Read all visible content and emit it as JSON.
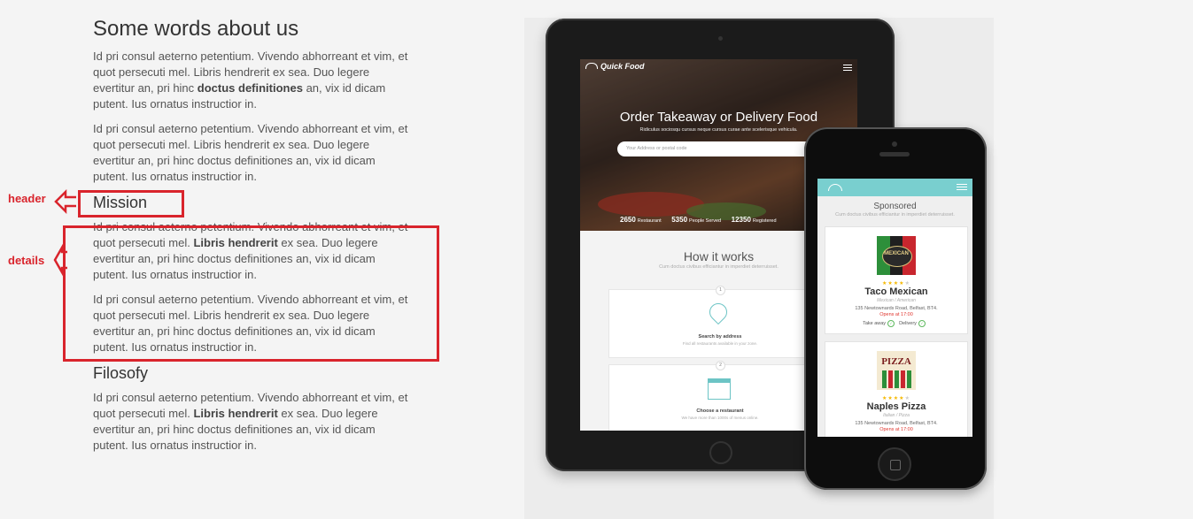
{
  "about": {
    "title": "Some words about us",
    "p1_before": "Id pri consul aeterno petentium. Vivendo abhorreant et vim, et quot persecuti mel. Libris hendrerit ex sea. Duo legere evertitur an, pri hinc ",
    "p1_bold": "doctus definitiones",
    "p1_after": " an, vix id dicam putent. Ius ornatus instructior in.",
    "p2": "Id pri consul aeterno petentium. Vivendo abhorreant et vim, et quot persecuti mel. Libris hendrerit ex sea. Duo legere evertitur an, pri hinc doctus definitiones an, vix id dicam putent. Ius ornatus instructior in."
  },
  "mission": {
    "title": "Mission",
    "p1_before": "Id pri consul aeterno petentium. Vivendo abhorreant et vim, et quot persecuti mel. ",
    "p1_bold": "Libris hendrerit",
    "p1_after": " ex sea. Duo legere evertitur an, pri hinc doctus definitiones an, vix id dicam putent. Ius ornatus instructior in.",
    "p2": "Id pri consul aeterno petentium. Vivendo abhorreant et vim, et quot persecuti mel. Libris hendrerit ex sea. Duo legere evertitur an, pri hinc doctus definitiones an, vix id dicam putent. Ius ornatus instructior in."
  },
  "filosofy": {
    "title": "Filosofy",
    "p1_before": "Id pri consul aeterno petentium. Vivendo abhorreant et vim, et quot persecuti mel. ",
    "p1_bold": "Libris hendrerit",
    "p1_after": " ex sea. Duo legere evertitur an, pri hinc doctus definitiones an, vix id dicam putent. Ius ornatus instructior in."
  },
  "annotations": {
    "header_label": "header",
    "details_label": "details",
    "color": "#d9242c"
  },
  "tablet": {
    "logo": "Quick Food",
    "hero_title": "Order Takeaway or Delivery Food",
    "hero_sub": "Ridiculus sociosqu cursus neque cursus curae ante scelerisque vehicula.",
    "address_placeholder": "Your Address or postal code",
    "stats": [
      {
        "num": "2650",
        "label": "Restaurant"
      },
      {
        "num": "5350",
        "label": "People Served"
      },
      {
        "num": "12350",
        "label": "Registered"
      }
    ],
    "how_title": "How it works",
    "how_sub": "Cum doctus civibus efficiantur in imperdiet deterruisset.",
    "steps": [
      {
        "num": "1",
        "title": "Search by address",
        "sub": "Find all restaurants available in your zone."
      },
      {
        "num": "2",
        "title": "Choose a restaurant",
        "sub": "We have more than 1000s of menus online."
      }
    ]
  },
  "phone": {
    "sponsored_title": "Sponsored",
    "sponsored_sub": "Cum doctus civibus efficiantur in imperdiet deterruisset.",
    "accent": "#79cfcf",
    "cards": [
      {
        "logo": "MEXICAN",
        "name": "Taco Mexican",
        "type": "Mexican / American",
        "address": "135 Newtownards Road, Belfast, BT4.",
        "open": "Opens at 17:00",
        "opt1": "Take away",
        "opt2": "Delivery"
      },
      {
        "logo": "PIZZA",
        "name": "Naples Pizza",
        "type": "Italian / Pizza",
        "address": "135 Newtownards Road, Belfast, BT4.",
        "open": "Opens at 17:00"
      }
    ]
  }
}
